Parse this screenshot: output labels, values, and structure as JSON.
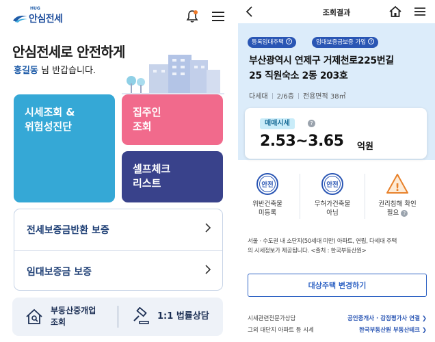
{
  "left": {
    "logo": {
      "small": "HUG",
      "name": "안심전세"
    },
    "headline": "안심전세로 안전하게",
    "greeting": {
      "user": "홍길동",
      "rest": " 님 반갑습니다."
    },
    "tiles": {
      "market": [
        "시세조회 &",
        "위험성진단"
      ],
      "landlord": [
        "집주인",
        "조회"
      ],
      "selfcheck": [
        "셀프체크",
        "리스트"
      ]
    },
    "list": [
      {
        "label": "전세보증금반환 보증"
      },
      {
        "label": "임대보증금 보증"
      }
    ],
    "bottom": {
      "agent": [
        "부동산중개업",
        "조회"
      ],
      "legal": "1:1 법률상담"
    }
  },
  "right": {
    "header": {
      "title": "조회결과"
    },
    "tags": [
      {
        "label": "등록임대주택"
      },
      {
        "label": "임대보증금보증 가입"
      }
    ],
    "address": [
      "부산광역시 연제구 거제천로225번길",
      "25 직원숙소 2동 203호"
    ],
    "meta": {
      "type": "다세대",
      "floor": "2/6층",
      "area": "전용면적 38㎡"
    },
    "price": {
      "label": "매매시세",
      "range": "2.53~3.65",
      "unit": "억원"
    },
    "checks": [
      {
        "badge": "안전",
        "label": [
          "위반건축물",
          "미등록"
        ]
      },
      {
        "badge": "안전",
        "label": [
          "무허가건축물",
          "아님"
        ]
      },
      {
        "badge": "!",
        "label": [
          "권리침해 확인",
          "필요"
        ]
      }
    ],
    "notice": [
      "서울 · 수도권 내 소단지(50세대 미만) 아파트, 연립, 다세대 주택",
      "의 시세정보가 제공됩니다. <출처 : 한국부동산원>"
    ],
    "change_button": "대상주택 변경하기",
    "links": [
      {
        "k": "시세관련전문가상담",
        "v": "공인중개사 · 감정평가사 연결 ❯"
      },
      {
        "k": "그외 대단지 아파트 등 시세",
        "v": "한국부동산원 부동산테크 ❯"
      }
    ],
    "colors": {
      "accent": "#2a56b4",
      "card": "#dcecfa",
      "warn": "#e8812a"
    }
  }
}
